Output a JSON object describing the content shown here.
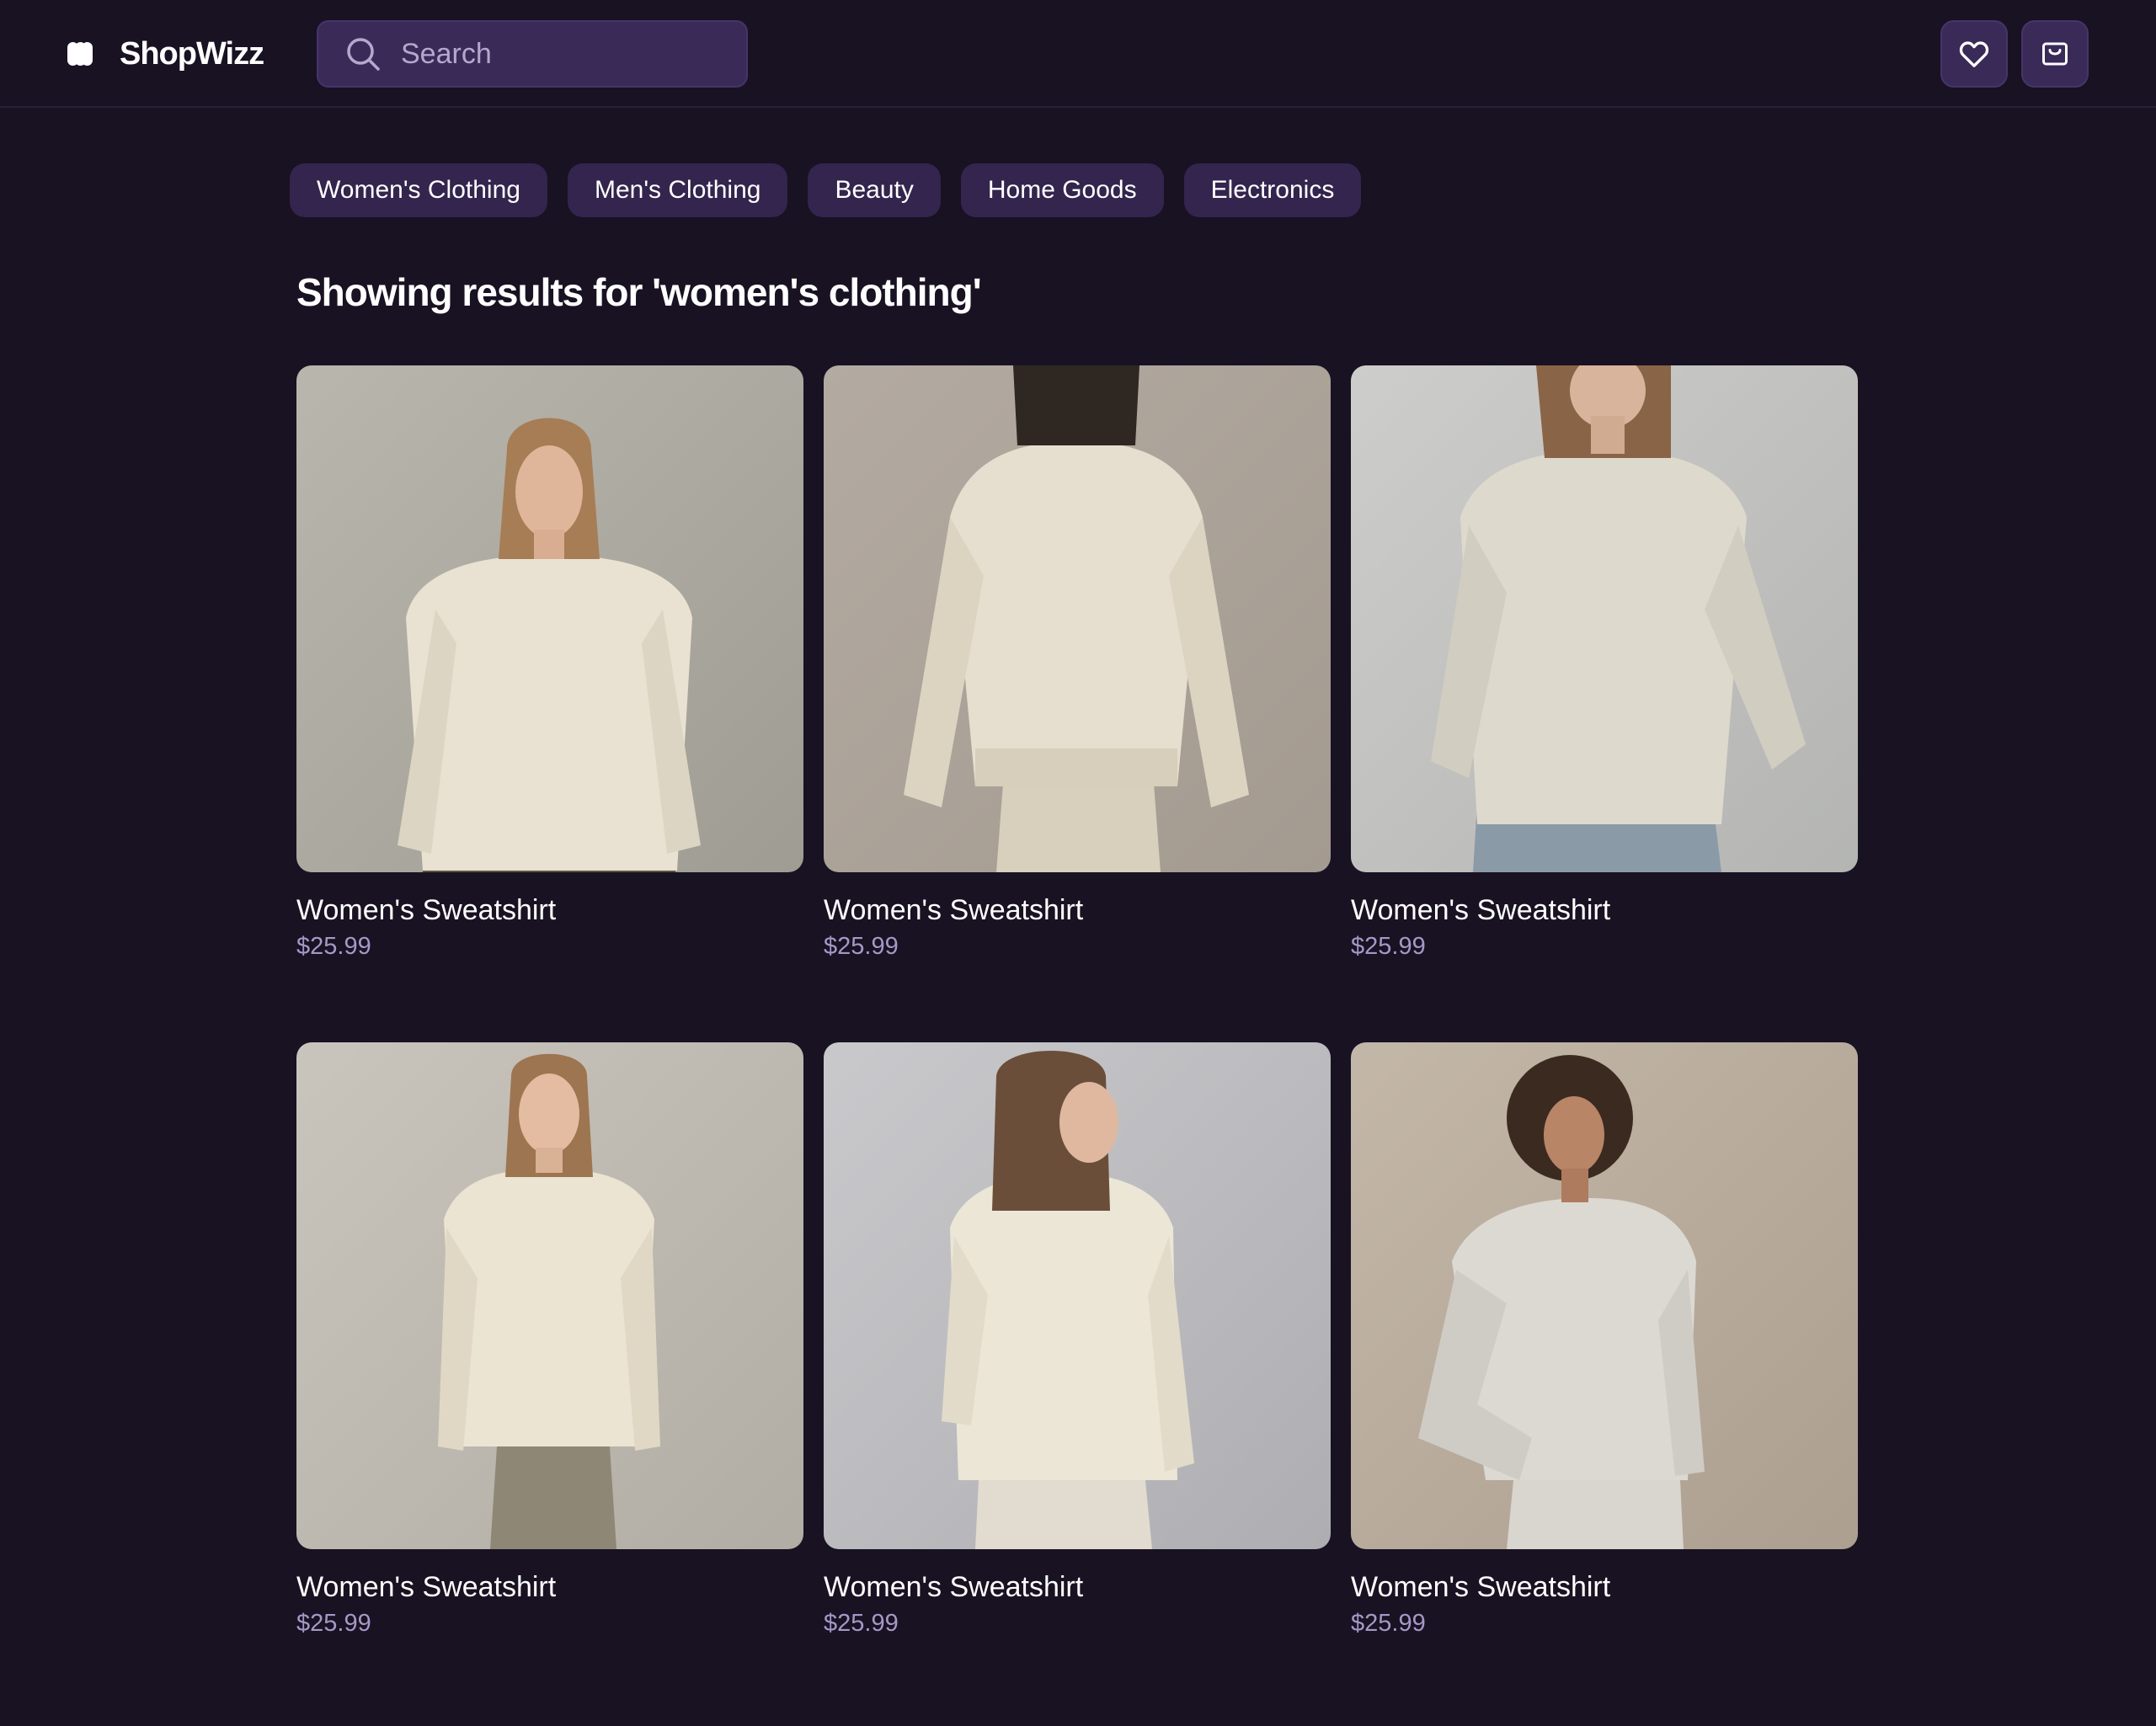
{
  "app": {
    "name": "ShopWizz"
  },
  "search": {
    "placeholder": "Search",
    "value": ""
  },
  "categories": [
    "Women's Clothing",
    "Men's Clothing",
    "Beauty",
    "Home Goods",
    "Electronics"
  ],
  "results_heading": "Showing results for 'women's clothing'",
  "products": [
    {
      "name": "Women's Sweatshirt",
      "price": "$25.99"
    },
    {
      "name": "Women's Sweatshirt",
      "price": "$25.99"
    },
    {
      "name": "Women's Sweatshirt",
      "price": "$25.99"
    },
    {
      "name": "Women's Sweatshirt",
      "price": "$25.99"
    },
    {
      "name": "Women's Sweatshirt",
      "price": "$25.99"
    },
    {
      "name": "Women's Sweatshirt",
      "price": "$25.99"
    }
  ],
  "icons": {
    "search": "search-icon",
    "wishlist": "heart-icon",
    "cart": "shopping-bag-icon",
    "logo": "logo-icon"
  },
  "colors": {
    "background": "#181222",
    "surface": "#3a2a58",
    "chip": "#33254d",
    "price": "#a797c7",
    "text": "#ffffff"
  }
}
